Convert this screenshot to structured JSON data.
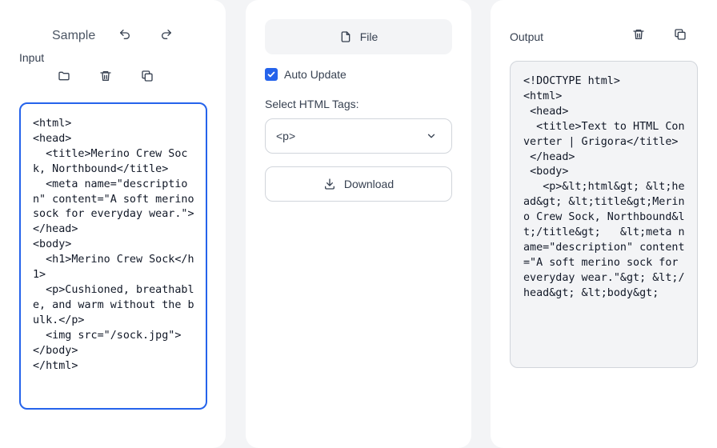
{
  "input_panel": {
    "sample_label": "Sample",
    "input_label": "Input",
    "input_text": "<html>\n<head>\n  <title>Merino Crew Sock, Northbound</title>\n  <meta name=\"description\" content=\"A soft merino sock for everyday wear.\">\n</head>\n<body>\n  <h1>Merino Crew Sock</h1>\n  <p>Cushioned, breathable, and warm without the bulk.</p>\n  <img src=\"/sock.jpg\">\n</body>\n</html>",
    "icons": {
      "undo": "undo-icon",
      "redo": "redo-icon",
      "open": "folder-icon",
      "clear": "trash-icon",
      "copy": "copy-icon"
    }
  },
  "controls_panel": {
    "file_label": "File",
    "auto_update_label": "Auto Update",
    "auto_update_checked": true,
    "select_tags_label": "Select HTML Tags:",
    "selected_tag": "<p>",
    "download_label": "Download"
  },
  "output_panel": {
    "output_label": "Output",
    "output_text": "<!DOCTYPE html>\n<html>\n <head>\n  <title>Text to HTML Converter | Grigora</title>\n </head>\n <body>\n   <p>&lt;html&gt; &lt;head&gt; &lt;title&gt;Merino Crew Sock, Northbound&lt;/title&gt;   &lt;meta name=\"description\" content=\"A soft merino sock for everyday wear.\"&gt; &lt;/head&gt; &lt;body&gt;"
  },
  "colors": {
    "accent": "#2563eb",
    "page_background": "#f3f4f6",
    "panel_background": "#ffffff"
  }
}
